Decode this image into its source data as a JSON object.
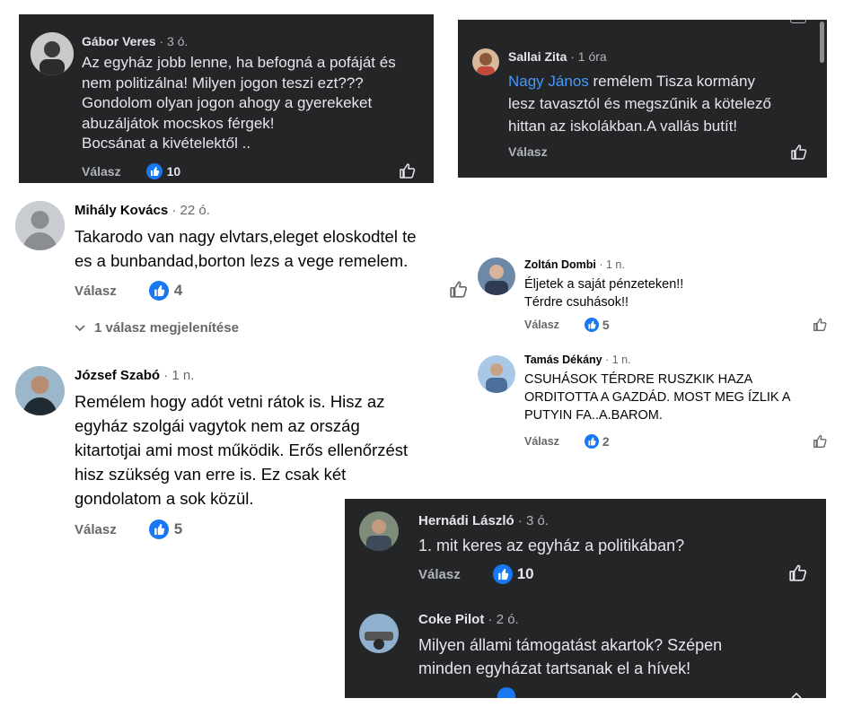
{
  "comments": [
    {
      "name": "Gábor Veres",
      "time": "· 3 ó.",
      "lines": [
        "Az egyház jobb lenne, ha befogná a pofáját és",
        "nem politizálna! Milyen jogon teszi ezt???",
        "Gondolom olyan jogon ahogy a gyerekeket",
        "abuzáljátok mocskos férgek!",
        "Bocsánat a kivételektől .."
      ],
      "reply": "Válasz",
      "likes": "10"
    },
    {
      "name": "Sallai Zita",
      "time": "· 1 óra",
      "mention": "Nagy János",
      "lines": [
        " remélem Tisza kormány",
        "lesz tavasztól és megszűnik a kötelező",
        "hittan az iskolákban.A vallás butít!"
      ],
      "reply": "Válasz",
      "likes": ""
    },
    {
      "name": "Mihály Kovács",
      "time": "· 22 ó.",
      "lines": [
        "Takarodo van nagy elvtars,eleget eloskodtel te",
        "es a bunbandad,borton lezs a vege remelem."
      ],
      "reply": "Válasz",
      "likes": "4",
      "replies_toggle": "1 válasz megjelenítése"
    },
    {
      "name": "Zoltán Dombi",
      "time": "· 1 n.",
      "lines": [
        "Éljetek a saját pénzeteken!!",
        "Térdre csuhások!!"
      ],
      "reply": "Válasz",
      "likes": "5"
    },
    {
      "name": "Tamás Dékány",
      "time": "· 1 n.",
      "lines": [
        "CSUHÁSOK TÉRDRE RUSZKIK HAZA",
        "ORDITOTTA A GAZDÁD. MOST MEG ÍZLIK A",
        "PUTYIN FA..A.BAROM."
      ],
      "reply": "Válasz",
      "likes": "2"
    },
    {
      "name": "József Szabó",
      "time": "· 1 n.",
      "lines": [
        "Remélem hogy adót vetni rátok is. Hisz az",
        "egyház szolgái vagytok nem az ország",
        "kitartotjai ami most működik. Erős ellenőrzést",
        "hisz szükség van erre is. Ez csak két",
        "gondolatom a sok közül."
      ],
      "reply": "Válasz",
      "likes": "5"
    },
    {
      "name": "Hernádi László",
      "time": "· 3 ó.",
      "lines": [
        "1. mit keres az egyház a politikában?"
      ],
      "reply": "Válasz",
      "likes": "10"
    },
    {
      "name": "Coke Pilot",
      "time": "· 2 ó.",
      "lines": [
        "Milyen állami támogatást akartok? Szépen",
        "minden egyházat tartsanak el a hívek!"
      ],
      "reply": "",
      "likes": ""
    }
  ],
  "colors": {
    "dark_bg": "#242526",
    "like_blue": "#1877f2",
    "mention": "#4599ff"
  }
}
